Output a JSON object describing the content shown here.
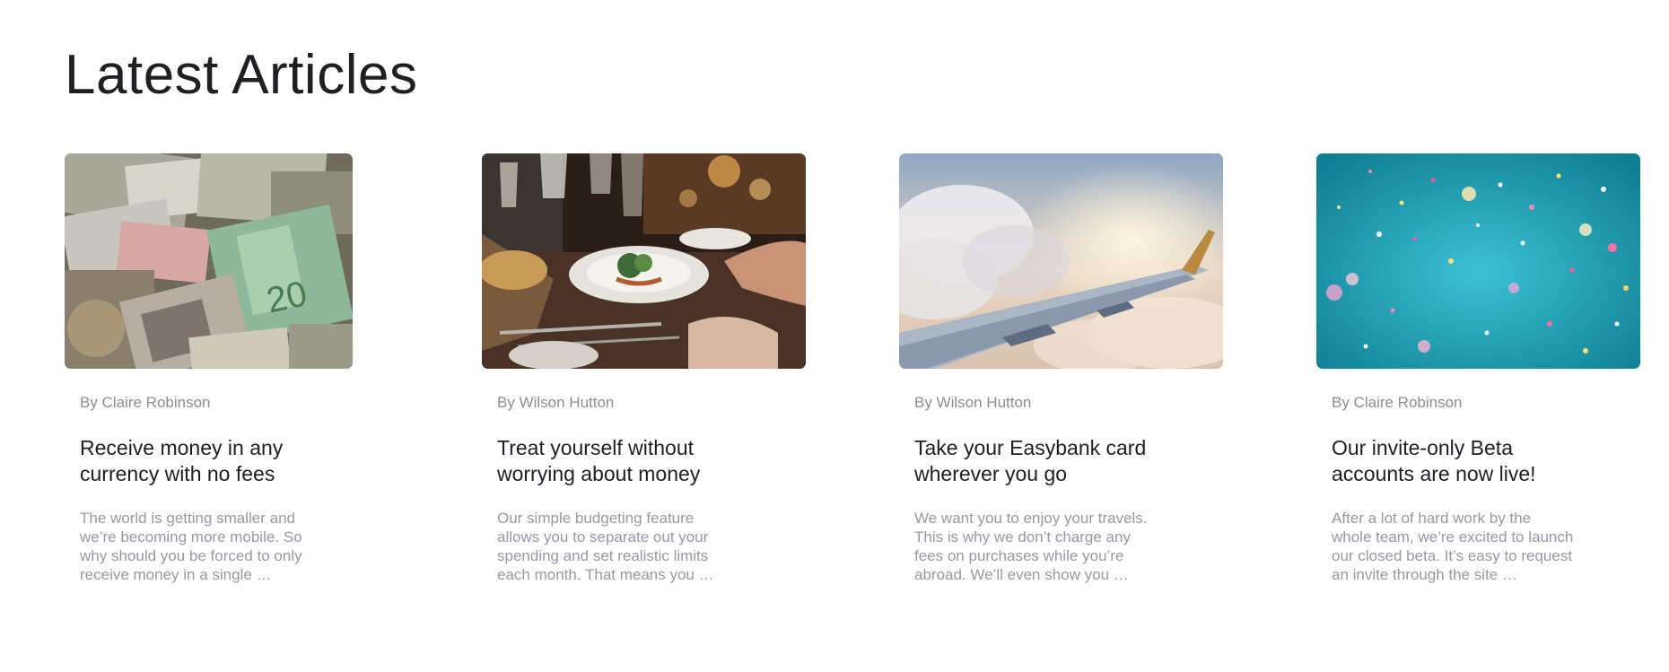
{
  "section": {
    "title": "Latest Articles"
  },
  "articles": [
    {
      "author": "By Claire Robinson",
      "title_lines": [
        "Receive money in any",
        "currency with no fees"
      ],
      "excerpt_lines": [
        "The world is getting smaller and",
        "we’re becoming more mobile. So",
        "why should you be forced to only",
        "receive money in a single …"
      ],
      "image": "currency-banknotes-image"
    },
    {
      "author": "By Wilson Hutton",
      "title_lines": [
        "Treat yourself without",
        "worrying about money"
      ],
      "excerpt_lines": [
        "Our simple budgeting feature",
        "allows you to separate out your",
        "spending and set realistic limits",
        "each month. That means you …"
      ],
      "image": "restaurant-dinner-image"
    },
    {
      "author": "By Wilson Hutton",
      "title_lines": [
        "Take your Easybank card",
        "wherever you go"
      ],
      "excerpt_lines": [
        "We want you to enjoy your travels.",
        "This is why we don’t charge any",
        "fees on purchases while you’re",
        "abroad. We’ll even show you …"
      ],
      "image": "airplane-wing-image"
    },
    {
      "author": "By Claire Robinson",
      "title_lines": [
        "Our invite-only Beta",
        "accounts are now live!"
      ],
      "excerpt_lines": [
        "After a lot of hard work by the",
        "whole team, we’re excited to launch",
        "our closed beta. It’s easy to request",
        "an invite through the site …"
      ],
      "image": "confetti-image"
    }
  ]
}
